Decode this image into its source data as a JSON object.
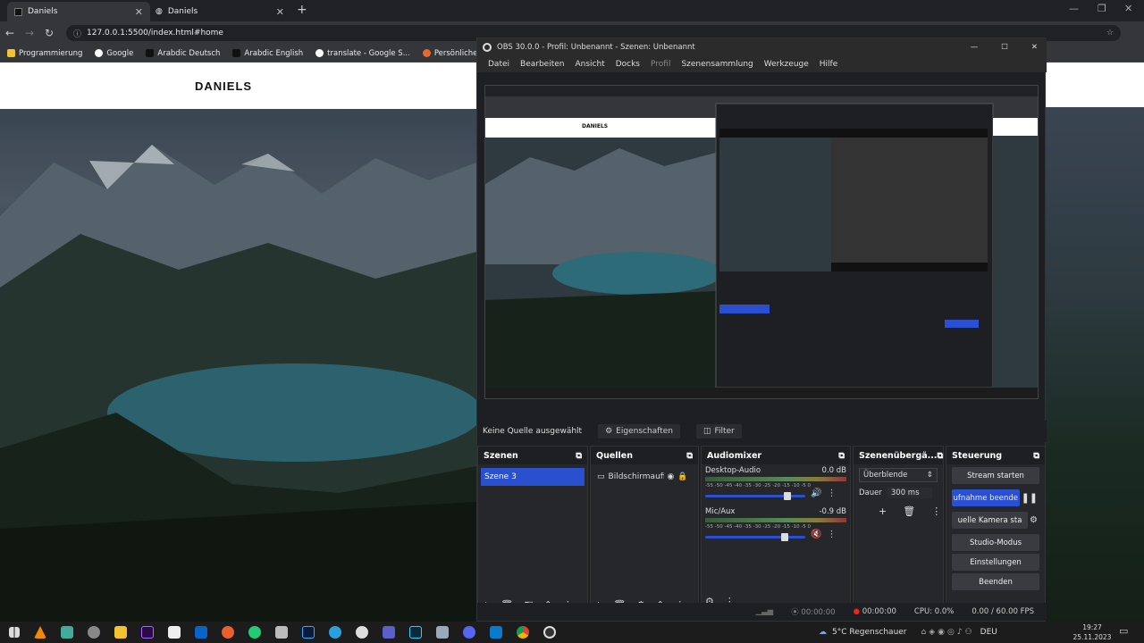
{
  "browser": {
    "tabs": [
      {
        "label": "Daniels",
        "active": true
      },
      {
        "label": "Daniels",
        "active": false
      }
    ],
    "url": "127.0.0.1:5500/index.html#home",
    "bookmarks": [
      "Programmierung",
      "Google",
      "Arabdic Deutsch",
      "Arabdic English",
      "translate - Google S...",
      "Persönliche Service..."
    ]
  },
  "page": {
    "brand": "DANIELS"
  },
  "obs": {
    "title": "OBS 30.0.0 - Profil: Unbenannt - Szenen: Unbenannt",
    "menu": [
      "Datei",
      "Bearbeiten",
      "Ansicht",
      "Docks",
      "Profil",
      "Szenensammlung",
      "Werkzeuge",
      "Hilfe"
    ],
    "preview_inner_brand": "DANIELS",
    "selection": {
      "none": "Keine Quelle ausgewählt",
      "properties": "Eigenschaften",
      "filter": "Filter"
    },
    "scenes": {
      "title": "Szenen",
      "items": [
        "Szene 3"
      ]
    },
    "sources": {
      "title": "Quellen",
      "items": [
        "Bildschirmaufi"
      ]
    },
    "mixer": {
      "title": "Audiomixer",
      "channels": [
        {
          "name": "Desktop-Audio",
          "db": "0.0 dB",
          "level": 0.85
        },
        {
          "name": "Mic/Aux",
          "db": "-0.9 dB",
          "level": 0.82
        }
      ],
      "scale": "-55 -50 -45 -40 -35 -30 -25 -20 -15 -10 -5 0"
    },
    "transitions": {
      "title": "Szenenübergä...",
      "selected": "Überblende",
      "duration_label": "Dauer",
      "duration": "300 ms"
    },
    "controls": {
      "title": "Steuerung",
      "stream": "Stream starten",
      "record": "ufnahme beende",
      "virtualcam": "uelle Kamera sta",
      "studio": "Studio-Modus",
      "settings": "Einstellungen",
      "exit": "Beenden"
    },
    "status": {
      "stream_time": "00:00:00",
      "rec_time": "00:00:00",
      "cpu": "CPU: 0.0%",
      "fps": "0.00 / 60.00 FPS"
    }
  },
  "taskbar": {
    "weather": "5°C  Regenschauer",
    "lang": "DEU",
    "time": "19:27",
    "date": "25.11.2023"
  }
}
